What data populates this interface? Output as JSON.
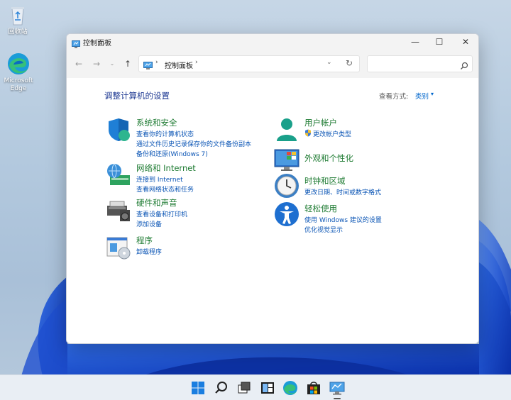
{
  "desktop": {
    "icons": [
      {
        "label": "回收站"
      },
      {
        "label": "Microsoft Edge"
      }
    ]
  },
  "window": {
    "title": "控制面板",
    "controls": {
      "minimize": "—",
      "maximize": "☐",
      "close": "✕"
    },
    "nav": {
      "back": "←",
      "forward": "→",
      "recent": "⌄",
      "up": "↑"
    },
    "address": {
      "sep1": "›",
      "crumb": "控制面板",
      "sep2": "›",
      "dropdown": "⌄",
      "refresh": "↻"
    },
    "search": {
      "placeholder": "",
      "value": ""
    },
    "content": {
      "heading": "调整计算机的设置",
      "view_by_label": "查看方式:",
      "view_by_value": "类别",
      "view_by_caret": "▾",
      "categories": [
        {
          "title": "系统和安全",
          "links": [
            "查看你的计算机状态",
            "通过文件历史记录保存你的文件备份副本",
            "备份和还原(Windows 7)"
          ],
          "icon": "shield-icon"
        },
        {
          "title": "网络和 Internet",
          "links": [
            "连接到 Internet",
            "查看网络状态和任务"
          ],
          "icon": "network-globe-icon"
        },
        {
          "title": "硬件和声音",
          "links": [
            "查看设备和打印机",
            "添加设备"
          ],
          "icon": "printer-speaker-icon"
        },
        {
          "title": "程序",
          "links": [
            "卸载程序"
          ],
          "icon": "programs-icon"
        },
        {
          "title": "用户帐户",
          "links": [
            "更改帐户类型"
          ],
          "icon": "user-icon"
        },
        {
          "title": "外观和个性化",
          "links": [],
          "icon": "monitor-palette-icon"
        },
        {
          "title": "时钟和区域",
          "links": [
            "更改日期、时间或数字格式"
          ],
          "icon": "clock-globe-icon"
        },
        {
          "title": "轻松使用",
          "links": [
            "使用 Windows 建议的设置",
            "优化视觉显示"
          ],
          "icon": "accessibility-icon"
        }
      ]
    }
  },
  "taskbar": {
    "items": [
      "start-icon",
      "search-icon",
      "task-view-icon",
      "widgets-icon",
      "edge-icon",
      "store-icon",
      "control-panel-icon"
    ],
    "watermark": "⠀⠀⠀⠀"
  },
  "colors": {
    "title_green": "#1e7b32",
    "link_blue": "#0b55b5",
    "heading_blue": "#1f3a93",
    "accent": "#0066cc"
  }
}
